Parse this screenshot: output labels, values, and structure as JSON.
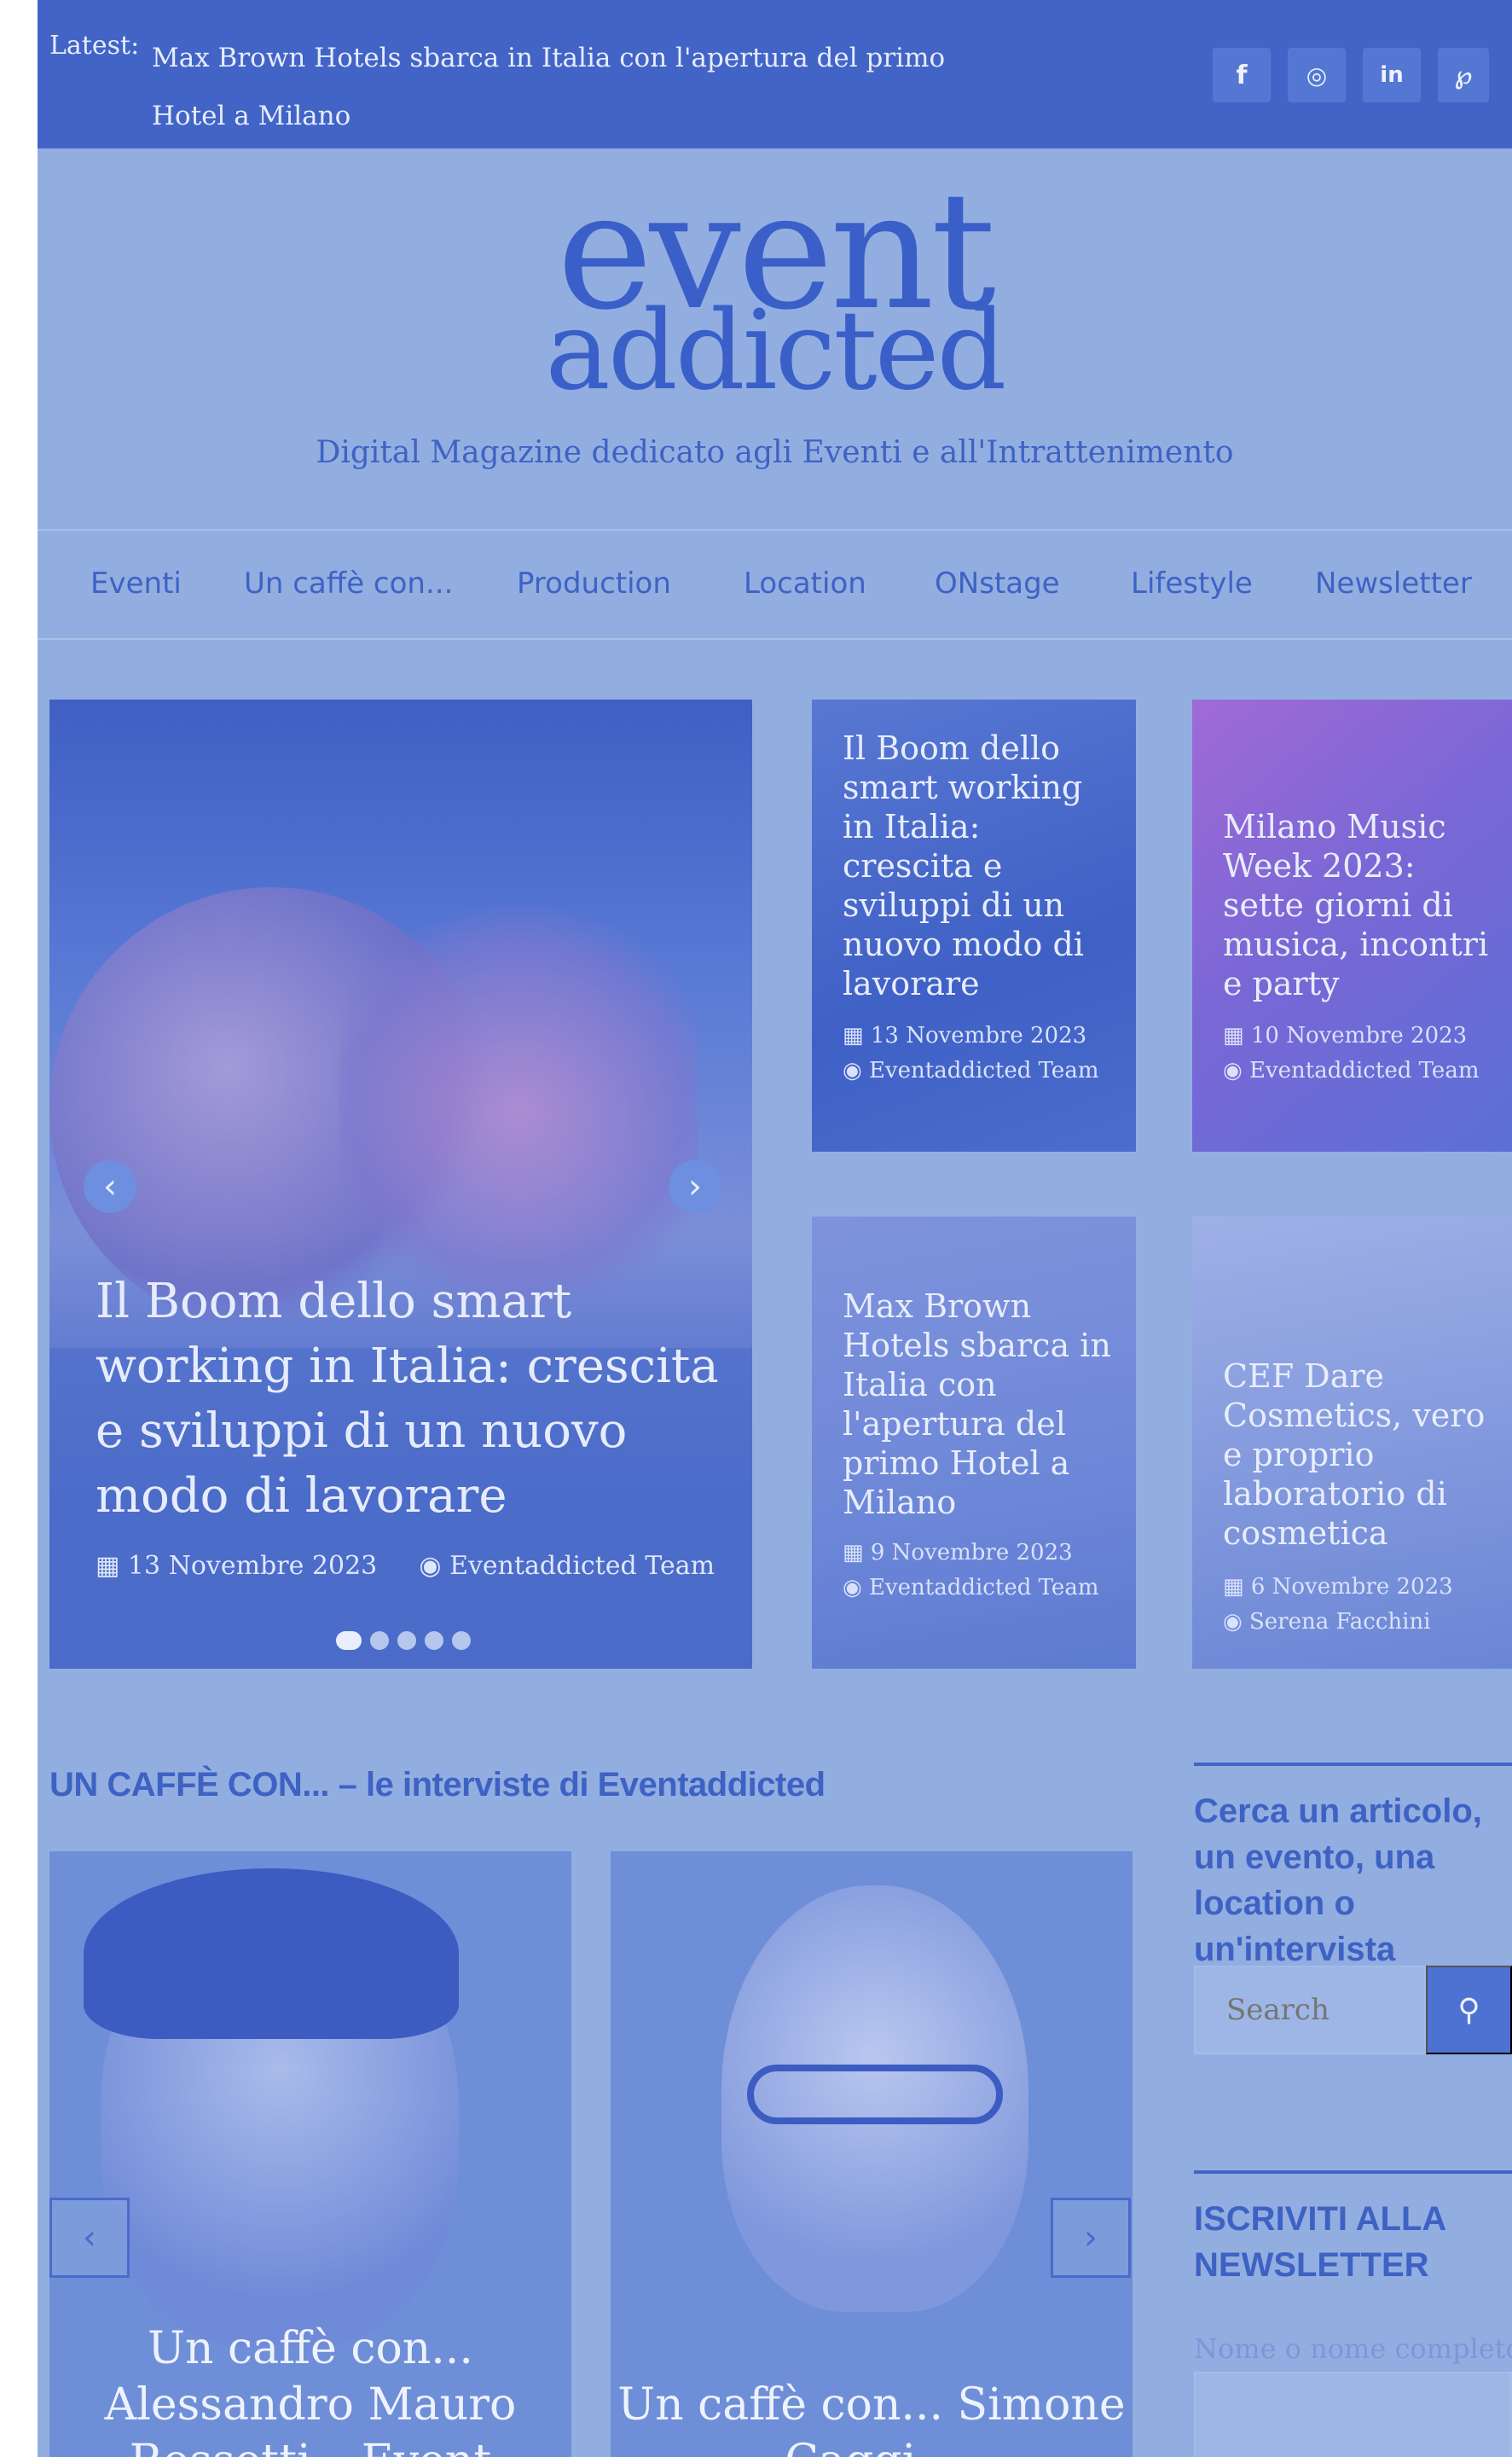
{
  "topbar": {
    "latest_label": "Latest:",
    "latest_text": "Max Brown Hotels sbarca in Italia con l'apertura del primo Hotel a Milano",
    "social": [
      {
        "icon": "facebook-icon",
        "glyph": "f"
      },
      {
        "icon": "instagram-icon",
        "glyph": "◎"
      },
      {
        "icon": "linkedin-icon",
        "glyph": "in"
      },
      {
        "icon": "pinterest-icon",
        "glyph": "℘"
      }
    ]
  },
  "header": {
    "logo_line1": "event",
    "logo_line2": "addicted",
    "tagline": "Digital Magazine dedicato agli Eventi e all'Intrattenimento"
  },
  "nav": {
    "items": [
      "Eventi",
      "Un caffè con...",
      "Production",
      "Location",
      "ONstage",
      "Lifestyle",
      "Newsletter"
    ]
  },
  "hero": {
    "title": "Il Boom dello smart working in Italia: crescita e sviluppi di un nuovo modo di lavorare",
    "date": "13 Novembre 2023",
    "author": "Eventaddicted Team",
    "prev": "‹",
    "next": "›",
    "slides": 5,
    "active_slide": 1
  },
  "cards": [
    {
      "title": "Il Boom dello smart working in Italia: crescita e sviluppi di un nuovo modo di lavorare",
      "date": "13 Novembre 2023",
      "author": "Eventaddicted Team"
    },
    {
      "title": "Milano Music Week 2023: sette giorni di musica, incontri e party",
      "date": "10 Novembre 2023",
      "author": "Eventaddicted Team"
    },
    {
      "title": "Max Brown Hotels sbarca in Italia con l'apertura del primo Hotel a Milano",
      "date": "9 Novembre 2023",
      "author": "Eventaddicted Team"
    },
    {
      "title": "CEF Dare Cosmetics, vero e proprio laboratorio di cosmetica",
      "date": "6 Novembre 2023",
      "author": "Serena Facchini"
    }
  ],
  "interviews": {
    "section_title": "UN CAFFÈ CON... – le interviste di Eventaddicted",
    "items": [
      {
        "title": "Un caffè con... Alessandro Mauro Rossetti – Event"
      },
      {
        "title": "Un caffè con... Simone Caggi..."
      }
    ],
    "prev": "‹",
    "next": "›"
  },
  "sidebar": {
    "search_heading": "Cerca un articolo, un evento, una location o un'intervista",
    "search_placeholder": "Search",
    "search_icon": "search-icon",
    "newsletter_heading": "ISCRIVITI ALLA NEWSLETTER",
    "newsletter_label": "Nome o nome completo"
  }
}
